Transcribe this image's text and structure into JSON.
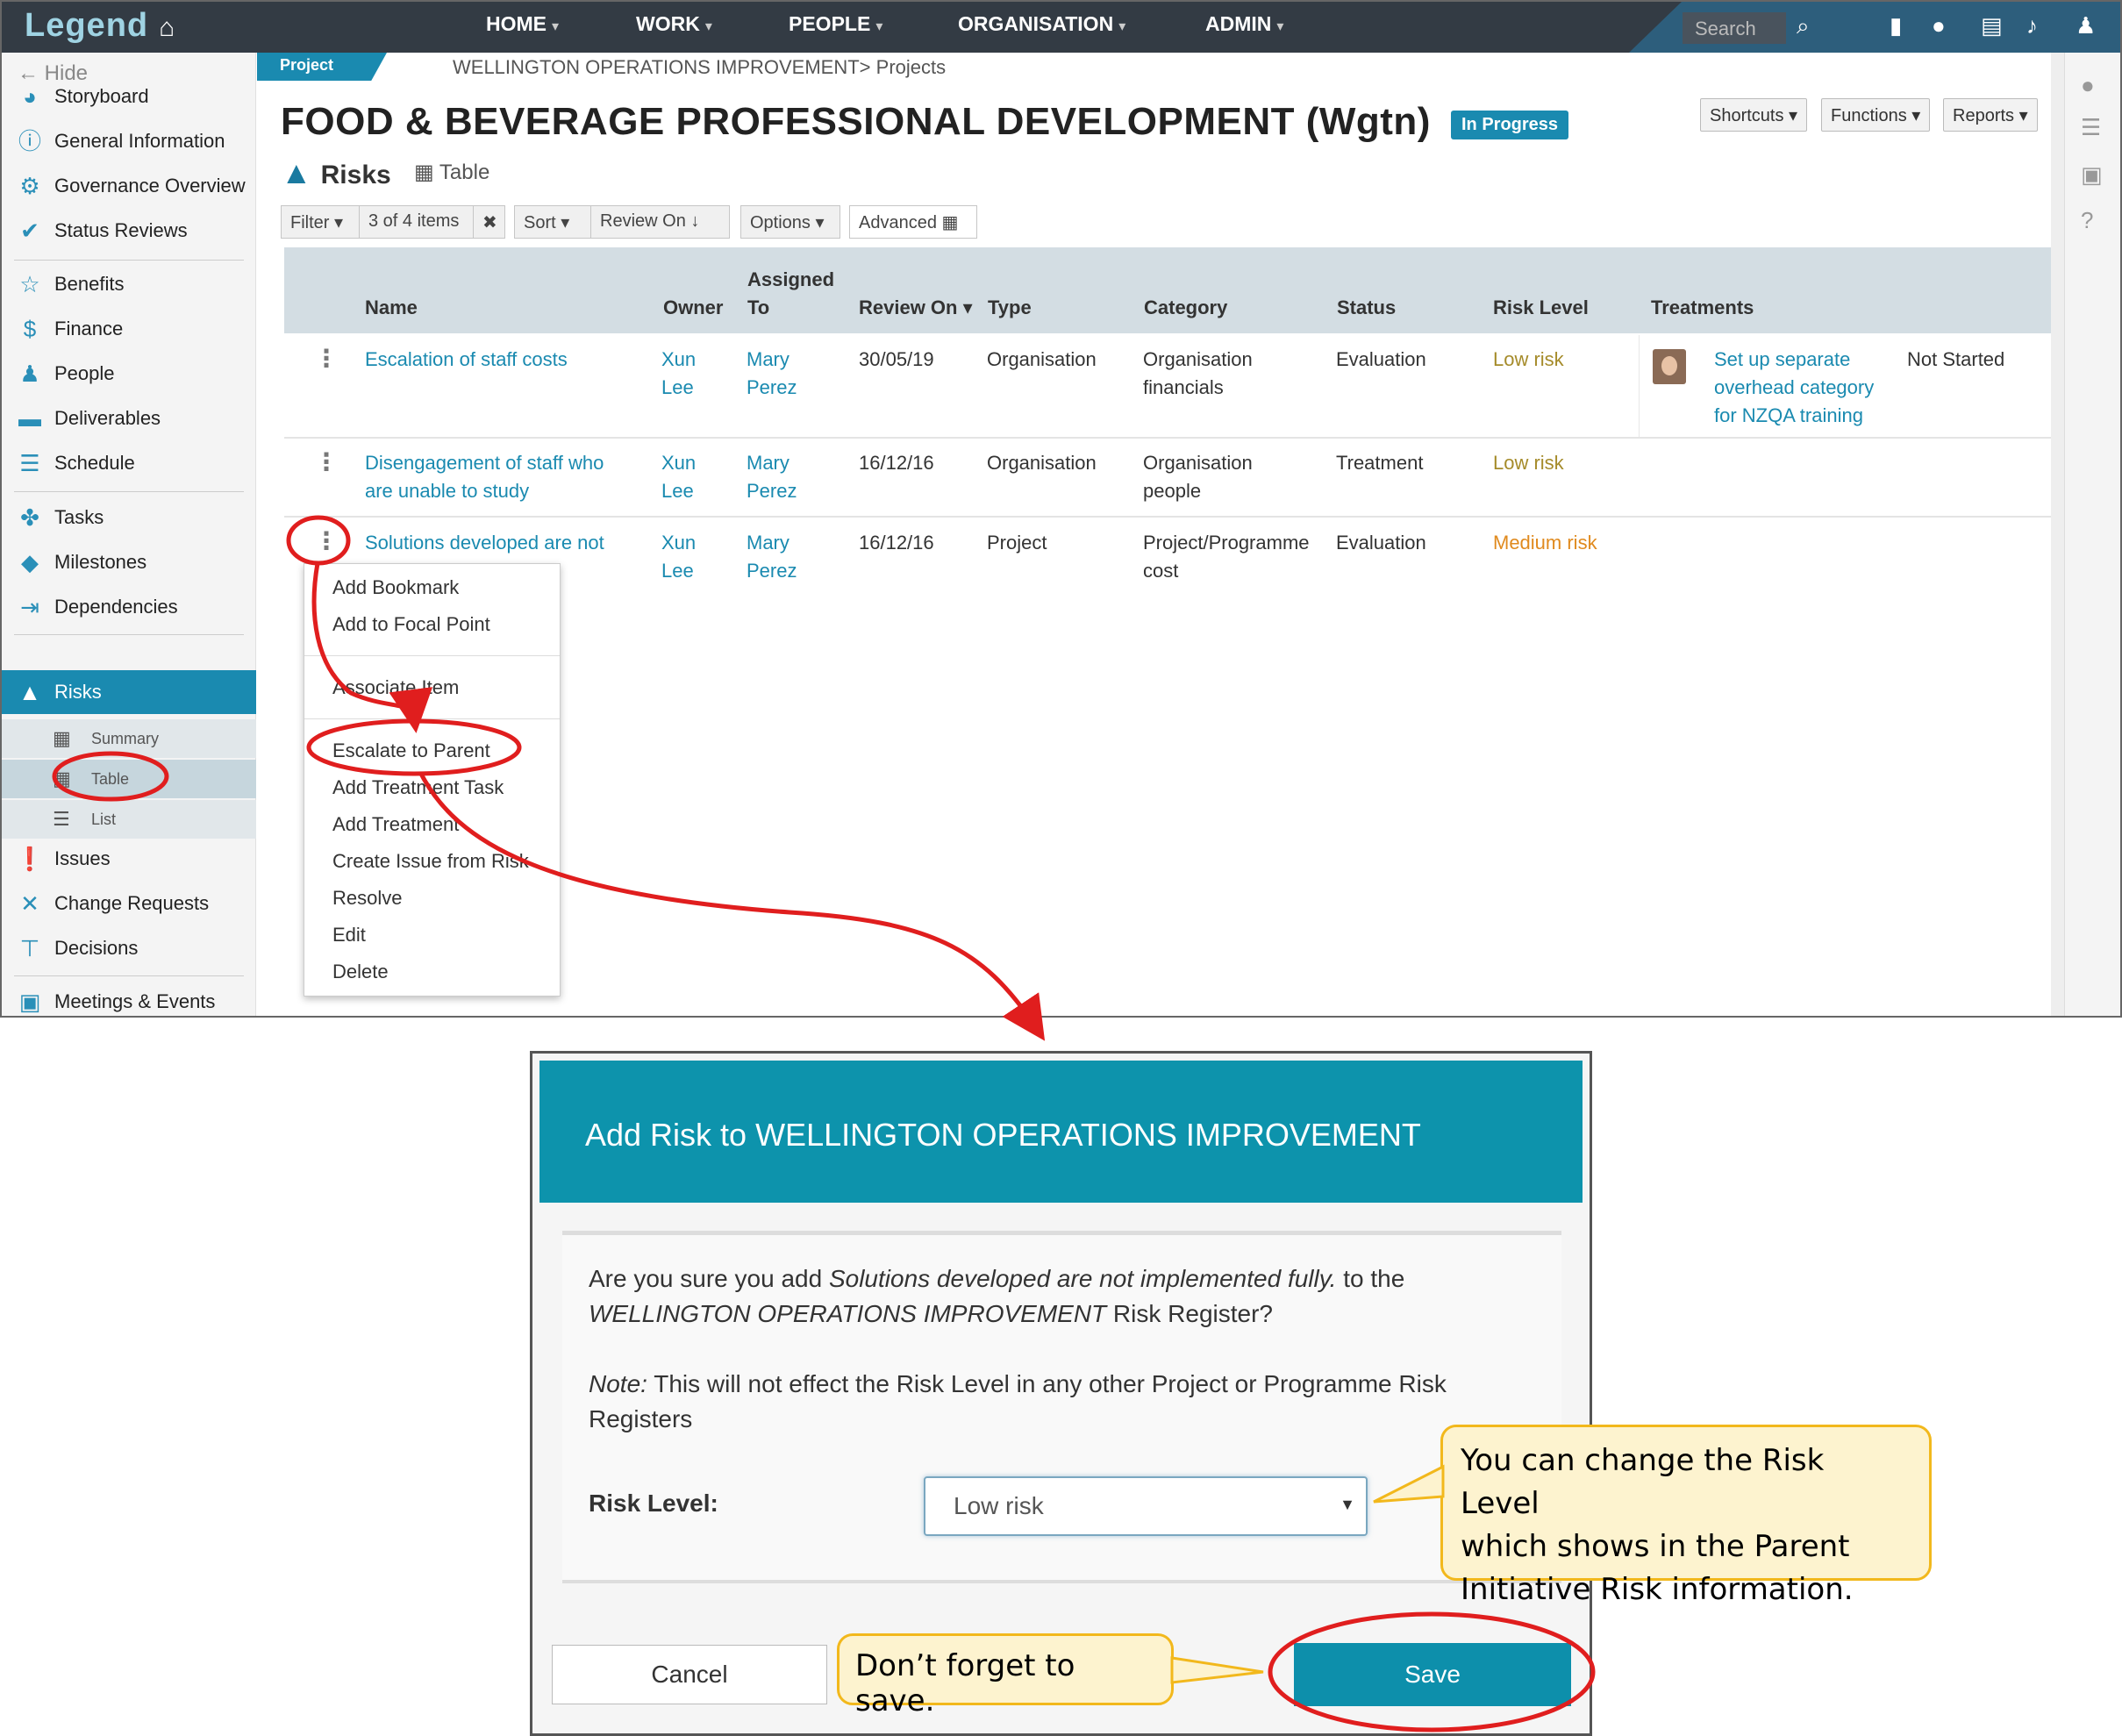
{
  "app": {
    "logo": "Legend",
    "nav": [
      {
        "label": "HOME"
      },
      {
        "label": "WORK"
      },
      {
        "label": "PEOPLE"
      },
      {
        "label": "ORGANISATION"
      },
      {
        "label": "ADMIN"
      }
    ],
    "search_placeholder": "Search"
  },
  "sidebar": {
    "hide_label": "Hide",
    "items": [
      {
        "label": "Storyboard",
        "icon": "dashboard-icon"
      },
      {
        "label": "General Information",
        "icon": "info-icon"
      },
      {
        "label": "Governance Overview",
        "icon": "governance-icon"
      },
      {
        "label": "Status Reviews",
        "icon": "check-icon"
      },
      {
        "label": "Benefits",
        "icon": "star-icon"
      },
      {
        "label": "Finance",
        "icon": "dollar-icon"
      },
      {
        "label": "People",
        "icon": "people-icon"
      },
      {
        "label": "Deliverables",
        "icon": "truck-icon"
      },
      {
        "label": "Schedule",
        "icon": "schedule-icon"
      },
      {
        "label": "Tasks",
        "icon": "tasks-icon"
      },
      {
        "label": "Milestones",
        "icon": "diamond-icon"
      },
      {
        "label": "Dependencies",
        "icon": "dependency-icon"
      },
      {
        "label": "Risks",
        "icon": "warning-icon"
      },
      {
        "label": "Issues",
        "icon": "exclamation-icon"
      },
      {
        "label": "Change Requests",
        "icon": "arrows-icon"
      },
      {
        "label": "Decisions",
        "icon": "signpost-icon"
      },
      {
        "label": "Meetings & Events",
        "icon": "calendar-icon"
      }
    ],
    "risk_sub": [
      {
        "label": "Summary",
        "icon": "grid-icon"
      },
      {
        "label": "Table",
        "icon": "table-icon"
      },
      {
        "label": "List",
        "icon": "list-icon"
      }
    ]
  },
  "page": {
    "tab_label": "Project",
    "breadcrumb": "WELLINGTON OPERATIONS IMPROVEMENT> Projects",
    "title": "FOOD & BEVERAGE PROFESSIONAL DEVELOPMENT (Wgtn)",
    "status": "In Progress",
    "header_buttons": {
      "shortcuts": "Shortcuts",
      "functions": "Functions",
      "reports": "Reports"
    },
    "section": "Risks",
    "view": "Table"
  },
  "toolbar": {
    "filter": "Filter",
    "filter_count": "3 of 4 items",
    "sort": "Sort",
    "sort_field": "Review On",
    "options": "Options",
    "advanced": "Advanced"
  },
  "table": {
    "headers": {
      "name": "Name",
      "owner": "Owner",
      "assigned_1": "Assigned",
      "assigned_2": "To",
      "review_on": "Review On",
      "type": "Type",
      "category": "Category",
      "status": "Status",
      "risk_level": "Risk Level",
      "treatments": "Treatments"
    },
    "rows": [
      {
        "name": [
          "Escalation of staff costs"
        ],
        "owner": [
          "Xun",
          "Lee"
        ],
        "assigned": [
          "Mary",
          "Perez"
        ],
        "review_on": "30/05/19",
        "type": "Organisation",
        "category": [
          "Organisation",
          "financials"
        ],
        "status": "Evaluation",
        "risk_level": "Low risk",
        "treatment": [
          "Set up separate",
          "overhead category",
          "for NZQA training"
        ],
        "treatment_status": "Not Started"
      },
      {
        "name": [
          "Disengagement of staff who",
          "are unable to study"
        ],
        "owner": [
          "Xun",
          "Lee"
        ],
        "assigned": [
          "Mary",
          "Perez"
        ],
        "review_on": "16/12/16",
        "type": "Organisation",
        "category": [
          "Organisation",
          "people"
        ],
        "status": "Treatment",
        "risk_level": "Low risk"
      },
      {
        "name": [
          "Solutions developed are not"
        ],
        "owner": [
          "Xun",
          "Lee"
        ],
        "assigned": [
          "Mary",
          "Perez"
        ],
        "review_on": "16/12/16",
        "type": "Project",
        "category": [
          "Project/Programme",
          "cost"
        ],
        "status": "Evaluation",
        "risk_level": "Medium risk"
      }
    ]
  },
  "context_menu": [
    "Add Bookmark",
    "Add to Focal Point",
    "Associate Item",
    "Escalate to Parent",
    "Add Treatment Task",
    "Add Treatment",
    "Create Issue from Risk",
    "Resolve",
    "Edit",
    "Delete"
  ],
  "dialog": {
    "title": "Add Risk to WELLINGTON OPERATIONS IMPROVEMENT",
    "question_prefix": "Are you sure you add ",
    "question_item": "Solutions developed are not implemented fully.",
    "question_mid": " to the",
    "question_register_name": "WELLINGTON OPERATIONS IMPROVEMENT",
    "question_suffix": " Risk Register?",
    "note_label": "Note:",
    "note_text": " This will not effect the Risk Level in any other Project or Programme Risk",
    "note_text_2": "Registers",
    "risk_level_label": "Risk Level:",
    "risk_level_value": "Low risk",
    "cancel": "Cancel",
    "save": "Save"
  },
  "callouts": {
    "risk_level": [
      "You can change the Risk Level",
      "which shows in the Parent",
      "Initiative Risk information."
    ],
    "save": "Don’t forget to save."
  },
  "colors": {
    "accent": "#1a8ab0",
    "dialog_header": "#0d93ac",
    "annotation_red": "#e01e1e",
    "callout_fill": "#fdf3cf",
    "callout_border": "#f2b81c",
    "low_risk": "#a58b2a",
    "medium_risk": "#e08a1e"
  }
}
